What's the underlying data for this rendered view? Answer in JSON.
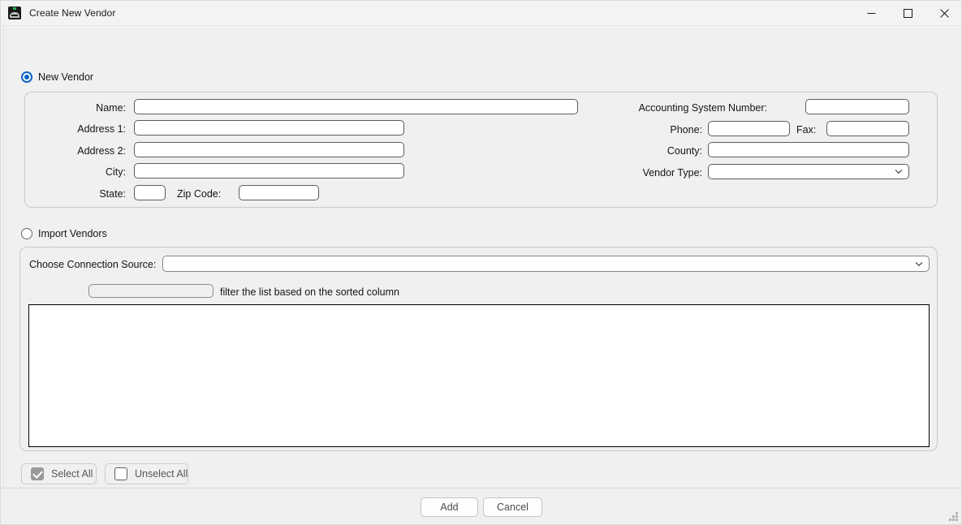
{
  "window": {
    "title": "Create New Vendor",
    "icon": "vendor-app-icon",
    "controls": {
      "minimize": "minimize-icon",
      "maximize": "maximize-icon",
      "close": "close-icon"
    }
  },
  "new_vendor": {
    "radio_label": "New Vendor",
    "selected": true,
    "fields": {
      "name": {
        "label": "Name:",
        "value": "",
        "placeholder": ""
      },
      "address1": {
        "label": "Address 1:",
        "value": "",
        "placeholder": ""
      },
      "address2": {
        "label": "Address 2:",
        "value": "",
        "placeholder": ""
      },
      "city": {
        "label": "City:",
        "value": "",
        "placeholder": ""
      },
      "state": {
        "label": "State:",
        "value": "",
        "placeholder": ""
      },
      "zip": {
        "label": "Zip Code:",
        "value": "",
        "placeholder": ""
      },
      "accounting_system_number": {
        "label": "Accounting System Number:",
        "value": "",
        "placeholder": ""
      },
      "phone": {
        "label": "Phone:",
        "value": "",
        "placeholder": ""
      },
      "fax": {
        "label": "Fax:",
        "value": "",
        "placeholder": ""
      },
      "county": {
        "label": "County:",
        "value": "",
        "placeholder": ""
      },
      "vendor_type": {
        "label": "Vendor Type:",
        "value": "",
        "options": []
      }
    }
  },
  "import_vendors": {
    "radio_label": "Import Vendors",
    "selected": false,
    "connection_source": {
      "label": "Choose Connection Source:",
      "value": "",
      "options": []
    },
    "filter": {
      "value": "",
      "placeholder": "",
      "hint": "filter the list based on the sorted column"
    },
    "list_items": []
  },
  "selection_bar": {
    "select_all": {
      "label": "Select All",
      "checked": true
    },
    "unselect_all": {
      "label": "Unselect All",
      "checked": false
    }
  },
  "footer": {
    "add_label": "Add",
    "cancel_label": "Cancel"
  },
  "colors": {
    "window_bg": "#f0f0f0",
    "titlebar_bg": "#f3f3f3",
    "accent": "#0a64c8",
    "group_border": "#c8c8c8",
    "input_border": "#5c5c5c",
    "list_border": "#000000",
    "text": "#141414",
    "muted_text": "#575757"
  }
}
